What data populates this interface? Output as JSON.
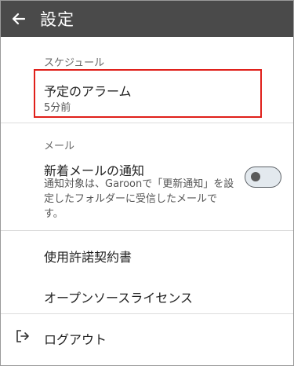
{
  "appbar": {
    "title": "設定",
    "back_icon": "arrow-left-icon"
  },
  "sections": {
    "schedule": {
      "header": "スケジュール",
      "alarm": {
        "title": "予定のアラーム",
        "value": "5分前"
      }
    },
    "mail": {
      "header": "メール",
      "notify": {
        "title": "新着メールの通知",
        "description": "通知対象は、Garoonで「更新通知」を設定したフォルダーに受信したメールです。",
        "enabled": false
      }
    },
    "license": {
      "terms_label": "使用許諾契約書",
      "oss_label": "オープンソースライセンス"
    },
    "logout": {
      "icon": "logout-icon",
      "label": "ログアウト"
    }
  },
  "colors": {
    "appbar_bg": "#4a4a4a",
    "highlight_border": "#e0201a",
    "toggle_track": "#e3e9ee",
    "toggle_knob": "#5a5a5a"
  }
}
